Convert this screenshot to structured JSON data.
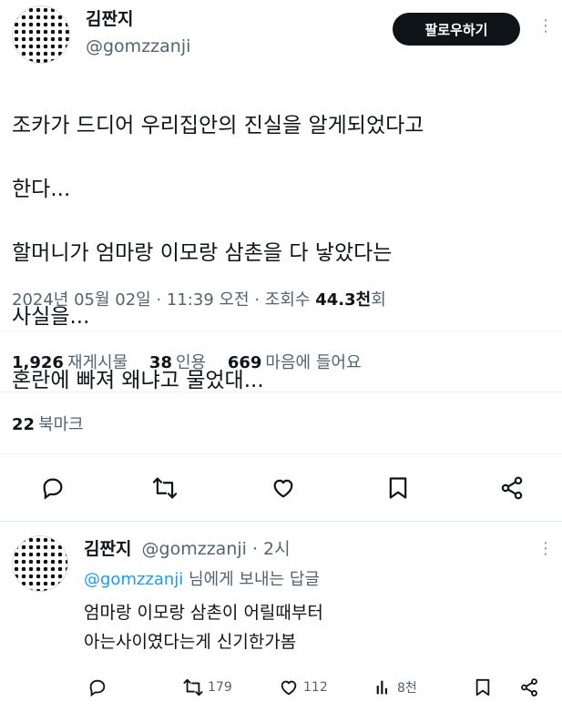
{
  "tweet": {
    "display_name": "김짠지",
    "handle": "@gomzzanji",
    "follow_label": "팔로우하기",
    "body_lines": [
      "조카가 드디어 우리집안의 진실을 알게되었다고",
      "한다...",
      "할머니가 엄마랑 이모랑 삼촌을 다 낳았다는",
      "사실을...",
      "혼란에 빠져 왜냐고 물었대..."
    ],
    "timestamp": "2024년 05월 02일 · 11:39 오전 · 조회수",
    "views_value": "44.3천",
    "views_suffix": "회",
    "stats": {
      "retweets_count": "1,926",
      "retweets_label": "재게시물",
      "quotes_count": "38",
      "quotes_label": "인용",
      "likes_count": "669",
      "likes_label": "마음에 들어요",
      "bookmarks_count": "22",
      "bookmarks_label": "북마크"
    }
  },
  "reply": {
    "display_name": "김짠지",
    "handle_time": "@gomzzanji · 2시",
    "replying_mention": "@gomzzanji",
    "replying_suffix": " 님에게 보내는 답글",
    "text_lines": [
      "엄마랑 이모랑 삼촌이 어릴때부터",
      "아는사이였다는게 신기한가봄"
    ],
    "retweets": "179",
    "likes": "112",
    "views": "8천"
  },
  "icons": [
    "reply-icon",
    "retweet-icon",
    "like-icon",
    "bookmark-icon",
    "share-icon",
    "views-icon",
    "more-icon"
  ],
  "colors": {
    "text": "#0f1419",
    "secondary": "#536471",
    "mention": "#1d9bf0",
    "follow_bg": "#0f1419"
  }
}
